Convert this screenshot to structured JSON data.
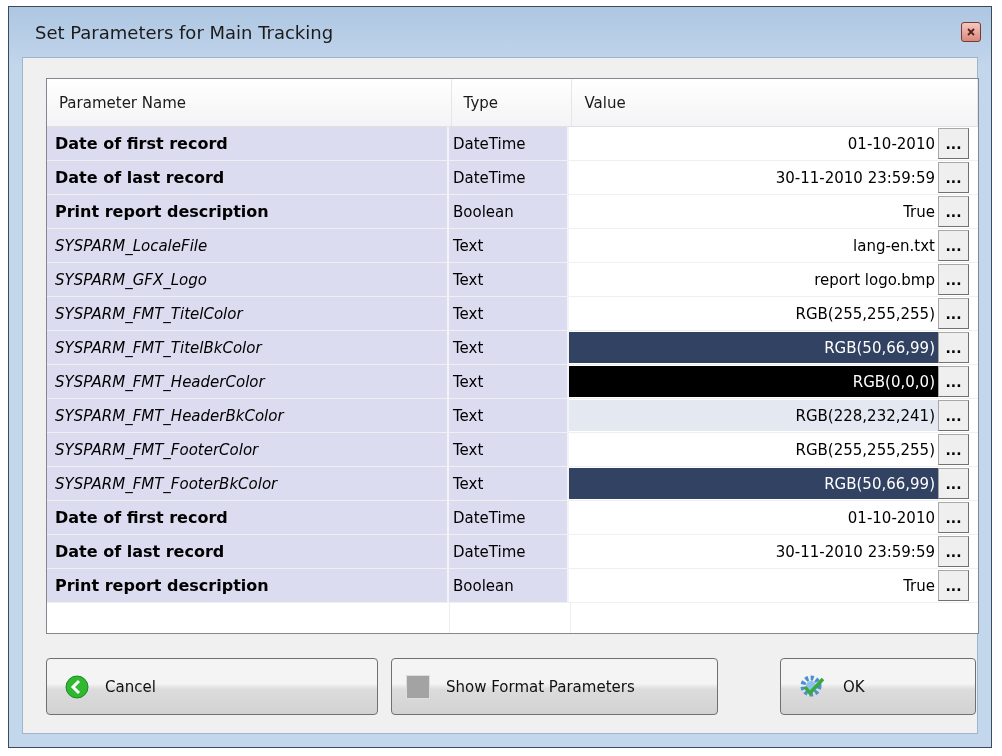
{
  "window": {
    "title": "Set Parameters for Main Tracking"
  },
  "table": {
    "columns": [
      "Parameter Name",
      "Type",
      "Value"
    ],
    "rows": [
      {
        "kind": "user",
        "name": "Date of first record",
        "type": "DateTime",
        "value": "01-10-2010",
        "button": "..."
      },
      {
        "kind": "user",
        "name": "Date of last record",
        "type": "DateTime",
        "value": "30-11-2010 23:59:59",
        "button": "..."
      },
      {
        "kind": "user",
        "name": "Print report description",
        "type": "Boolean",
        "value": "True",
        "button": "..."
      },
      {
        "kind": "system",
        "name": "SYSPARM_LocaleFile",
        "type": "Text",
        "value": "lang-en.txt",
        "button": "..."
      },
      {
        "kind": "system",
        "name": "SYSPARM_GFX_Logo",
        "type": "Text",
        "value": "report logo.bmp",
        "button": "..."
      },
      {
        "kind": "system",
        "name": "SYSPARM_FMT_TitelColor",
        "type": "Text",
        "value": "RGB(255,255,255)",
        "button": "...",
        "color": "#ffffff"
      },
      {
        "kind": "system",
        "name": "SYSPARM_FMT_TitelBkColor",
        "type": "Text",
        "value": "RGB(50,66,99)",
        "button": "...",
        "color": "#324263"
      },
      {
        "kind": "system",
        "name": "SYSPARM_FMT_HeaderColor",
        "type": "Text",
        "value": "RGB(0,0,0)",
        "button": "...",
        "color": "#000000"
      },
      {
        "kind": "system",
        "name": "SYSPARM_FMT_HeaderBkColor",
        "type": "Text",
        "value": "RGB(228,232,241)",
        "button": "...",
        "color": "#e4e8f1"
      },
      {
        "kind": "system",
        "name": "SYSPARM_FMT_FooterColor",
        "type": "Text",
        "value": "RGB(255,255,255)",
        "button": "...",
        "color": "#ffffff"
      },
      {
        "kind": "system",
        "name": "SYSPARM_FMT_FooterBkColor",
        "type": "Text",
        "value": "RGB(50,66,99)",
        "button": "...",
        "color": "#324263"
      },
      {
        "kind": "user",
        "name": "Date of first record",
        "type": "DateTime",
        "value": "01-10-2010",
        "button": "..."
      },
      {
        "kind": "user",
        "name": "Date of last record",
        "type": "DateTime",
        "value": "30-11-2010 23:59:59",
        "button": "..."
      },
      {
        "kind": "user",
        "name": "Print report description",
        "type": "Boolean",
        "value": "True",
        "button": "..."
      }
    ]
  },
  "buttons": [
    {
      "kind": "cancel",
      "label": "Cancel"
    },
    {
      "kind": "format",
      "label": "Show Format Parameters"
    },
    {
      "kind": "ok",
      "label": "OK"
    }
  ]
}
